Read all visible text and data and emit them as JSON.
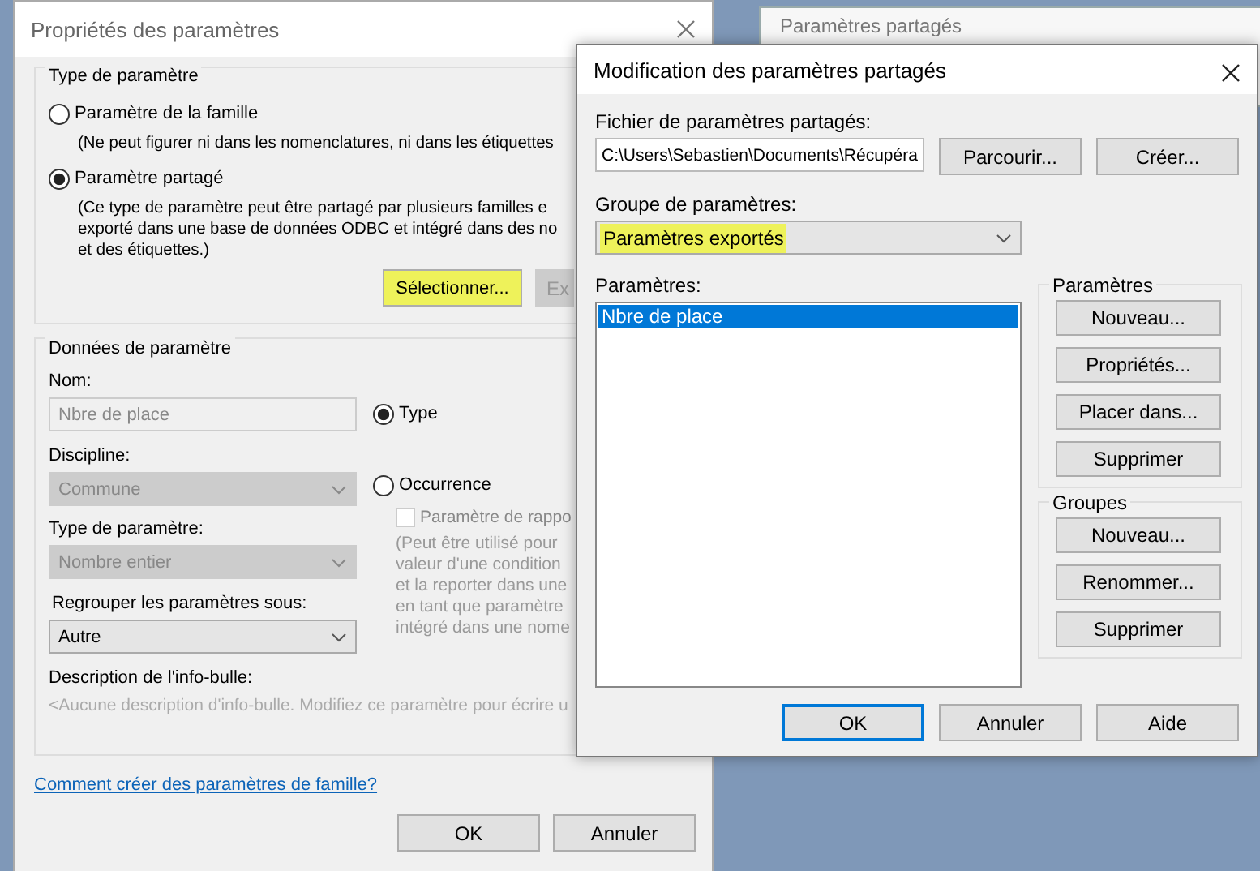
{
  "background_window": {
    "title": "Paramètres partagés"
  },
  "properties_dialog": {
    "title": "Propriétés des paramètres",
    "parameter_type": {
      "legend": "Type de paramètre",
      "options": [
        {
          "label": "Paramètre de la famille",
          "selected": false,
          "note": [
            "(Ne peut figurer ni dans les nomenclatures, ni dans les étiquettes"
          ]
        },
        {
          "label": "Paramètre partagé",
          "selected": true,
          "note": [
            "(Ce type de paramètre peut être partagé par plusieurs familles e",
            "exporté dans une base de données ODBC et intégré dans des no",
            "et des étiquettes.)"
          ]
        }
      ],
      "buttons": [
        {
          "label": "Sélectionner...",
          "disabled": false,
          "highlighted": true
        },
        {
          "label": "Ex",
          "disabled": true,
          "highlighted": false
        }
      ]
    },
    "parameter_data": {
      "legend": "Données de paramètre",
      "name": {
        "label": "Nom:",
        "value": "Nbre de place",
        "disabled": true
      },
      "discipline": {
        "label": "Discipline:",
        "value": "Commune",
        "disabled": true
      },
      "parameter_type": {
        "label": "Type de paramètre:",
        "value": "Nombre entier",
        "disabled": true
      },
      "group_under": {
        "label": "Regrouper les paramètres sous:",
        "value": "Autre",
        "disabled": false
      },
      "scope": [
        {
          "label": "Type",
          "selected": true
        },
        {
          "label": "Occurrence",
          "selected": false
        }
      ],
      "reporting": {
        "label": "Paramètre de rappo",
        "checked": false,
        "disabled": true
      },
      "reporting_note": [
        "(Peut être utilisé pour",
        "valeur d'une condition",
        "et la reporter dans une",
        "en tant que paramètre",
        "intégré dans une nome"
      ],
      "tooltip": {
        "label": "Description de l'info-bulle:",
        "text": "<Aucune description d'info-bulle. Modifiez ce paramètre pour écrire u"
      }
    },
    "help_link": "Comment créer des paramètres de famille?",
    "buttons": [
      {
        "label": "OK"
      },
      {
        "label": "Annuler"
      }
    ]
  },
  "shared_dialog": {
    "title": "Modification des paramètres partagés",
    "file": {
      "label": "Fichier de paramètres partagés:",
      "value": "C:\\Users\\Sebastien\\Documents\\Récupéra"
    },
    "file_buttons": [
      {
        "label": "Parcourir..."
      },
      {
        "label": "Créer..."
      }
    ],
    "group": {
      "label": "Groupe de paramètres:",
      "value": "Paramètres exportés",
      "highlighted": true
    },
    "parameters": {
      "label": "Paramètres:",
      "items": [
        {
          "label": "Nbre de place",
          "selected": true
        }
      ]
    },
    "parameter_buttons": {
      "legend": "Paramètres",
      "buttons": [
        {
          "label": "Nouveau..."
        },
        {
          "label": "Propriétés..."
        },
        {
          "label": "Placer dans..."
        },
        {
          "label": "Supprimer"
        }
      ]
    },
    "group_buttons": {
      "legend": "Groupes",
      "buttons": [
        {
          "label": "Nouveau..."
        },
        {
          "label": "Renommer..."
        },
        {
          "label": "Supprimer"
        }
      ]
    },
    "buttons": [
      {
        "label": "OK",
        "default": true
      },
      {
        "label": "Annuler",
        "default": false
      },
      {
        "label": "Aide",
        "default": false
      }
    ]
  }
}
